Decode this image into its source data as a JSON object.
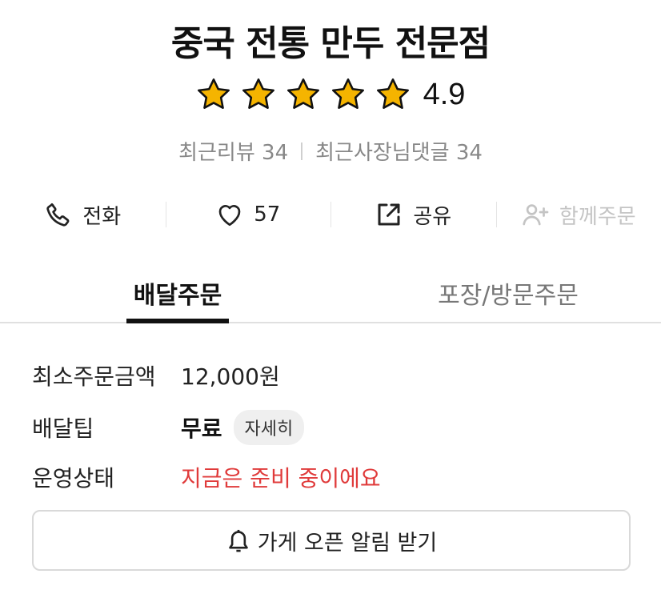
{
  "store": {
    "name": "중국 전통 만두 전문점",
    "rating": "4.9",
    "stars_filled": 5,
    "stars_total": 5,
    "star_color": "#F5B400",
    "recent_reviews": "최근리뷰 34",
    "recent_owner_comments": "최근사장님댓글 34"
  },
  "actions": {
    "call": {
      "label": "전화",
      "icon": "phone-icon"
    },
    "like": {
      "count": "57",
      "icon": "heart-icon"
    },
    "share": {
      "label": "공유",
      "icon": "share-icon"
    },
    "group_order": {
      "label": "함께주문",
      "icon": "add-person-icon",
      "disabled": true
    }
  },
  "tabs": {
    "delivery": "배달주문",
    "pickup": "포장/방문주문",
    "active": "delivery"
  },
  "info": {
    "min_order_label": "최소주문금액",
    "min_order_value": "12,000원",
    "delivery_tip_label": "배달팁",
    "delivery_tip_value": "무료",
    "detail_label": "자세히",
    "status_label": "운영상태",
    "status_value": "지금은 준비 중이에요",
    "status_color": "#E03B3B"
  },
  "notify_button": {
    "label": "가게 오픈 알림 받기",
    "icon": "bell-icon"
  }
}
